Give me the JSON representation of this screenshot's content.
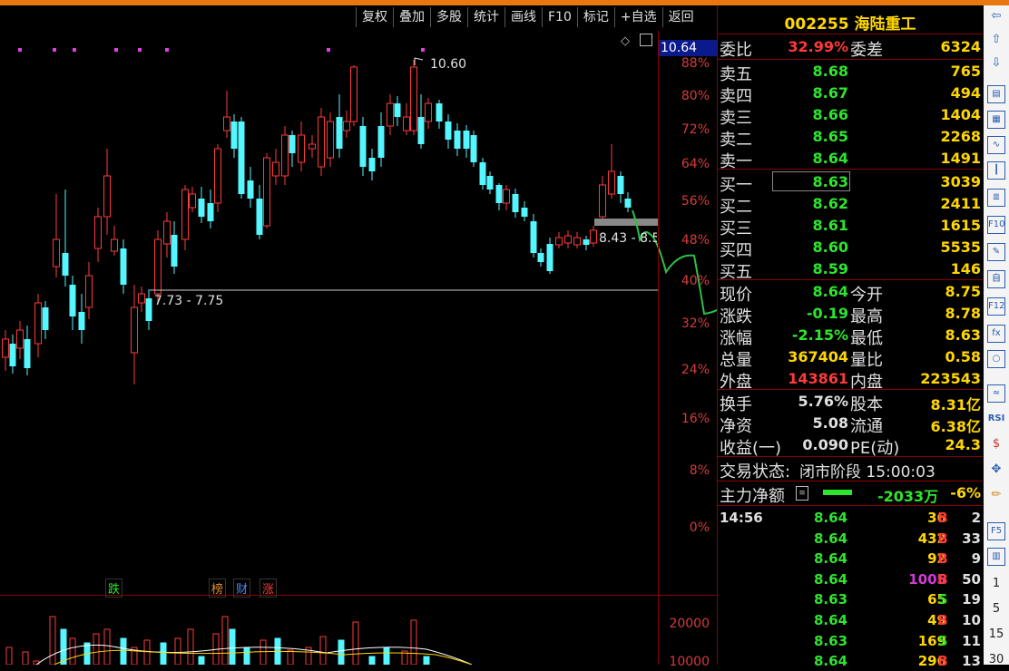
{
  "toolbar": {
    "items": [
      "复权",
      "叠加",
      "多股",
      "统计",
      "画线",
      "F10",
      "标记",
      "+自选",
      "返回"
    ]
  },
  "stock": {
    "code": "002255",
    "name": "海陆重工"
  },
  "chart": {
    "current_price_label": "10.64",
    "high_marker": "10.60",
    "range_label_1": "7.73 - 7.75",
    "range_label_2": "8.43 - 8.5",
    "pct_ticks": [
      "88%",
      "80%",
      "72%",
      "64%",
      "56%",
      "48%",
      "40%",
      "32%",
      "24%",
      "16%",
      "8%",
      "0%"
    ],
    "vol_ticks": [
      "20000",
      "10000"
    ],
    "badges": {
      "die": "跌",
      "bang": "榜",
      "cai": "财",
      "zhang": "涨"
    }
  },
  "chart_data": {
    "type": "candlestick",
    "high": 10.6,
    "support_range": "7.73 - 7.75",
    "resistance_range": "8.43 - 8.5"
  },
  "quote": {
    "weibi": {
      "label": "委比",
      "value": "32.99%",
      "label2": "委差",
      "value2": "6324"
    },
    "sell": [
      {
        "label": "卖五",
        "price": "8.68",
        "vol": "765"
      },
      {
        "label": "卖四",
        "price": "8.67",
        "vol": "494"
      },
      {
        "label": "卖三",
        "price": "8.66",
        "vol": "1404"
      },
      {
        "label": "卖二",
        "price": "8.65",
        "vol": "2268"
      },
      {
        "label": "卖一",
        "price": "8.64",
        "vol": "1491"
      }
    ],
    "buy": [
      {
        "label": "买一",
        "price": "8.63",
        "vol": "3039"
      },
      {
        "label": "买二",
        "price": "8.62",
        "vol": "2411"
      },
      {
        "label": "买三",
        "price": "8.61",
        "vol": "1615"
      },
      {
        "label": "买四",
        "price": "8.60",
        "vol": "5535"
      },
      {
        "label": "买五",
        "price": "8.59",
        "vol": "146"
      }
    ],
    "stats": [
      {
        "l1": "现价",
        "v1": "8.64",
        "l2": "今开",
        "v2": "8.75"
      },
      {
        "l1": "涨跌",
        "v1": "-0.19",
        "l2": "最高",
        "v2": "8.78"
      },
      {
        "l1": "涨幅",
        "v1": "-2.15%",
        "l2": "最低",
        "v2": "8.63"
      },
      {
        "l1": "总量",
        "v1": "367404",
        "l2": "量比",
        "v2": "0.58"
      },
      {
        "l1": "外盘",
        "v1": "143861",
        "l2": "内盘",
        "v2": "223543"
      }
    ],
    "stats2": [
      {
        "l1": "换手",
        "v1": "5.76%",
        "l2": "股本",
        "v2": "8.31亿"
      },
      {
        "l1": "净资",
        "v1": "5.08",
        "l2": "流通",
        "v2": "6.38亿"
      },
      {
        "l1": "收益(一)",
        "v1": "0.090",
        "l2": "PE(动)",
        "v2": "24.3"
      }
    ],
    "status_label": "交易状态:",
    "status_value": "闭市阶段 15:00:03",
    "mainforce_label": "主力净额",
    "mainforce_value": "-2033万",
    "mainforce_pct": "-6%"
  },
  "ticks": [
    {
      "time": "14:56",
      "price": "8.64",
      "qty": "36",
      "bs": "B",
      "n": "2"
    },
    {
      "time": "",
      "price": "8.64",
      "qty": "432",
      "bs": "B",
      "n": "33"
    },
    {
      "time": "",
      "price": "8.64",
      "qty": "92",
      "bs": "B",
      "n": "9"
    },
    {
      "time": "",
      "price": "8.64",
      "qty": "1005",
      "bs": "B",
      "n": "50"
    },
    {
      "time": "",
      "price": "8.63",
      "qty": "65",
      "bs": "S",
      "n": "19"
    },
    {
      "time": "",
      "price": "8.64",
      "qty": "49",
      "bs": "B",
      "n": "10"
    },
    {
      "time": "",
      "price": "8.63",
      "qty": "169",
      "bs": "S",
      "n": "11"
    },
    {
      "time": "",
      "price": "8.64",
      "qty": "296",
      "bs": "B",
      "n": "13"
    }
  ],
  "tools": {
    "arrows": [
      "⇦",
      "⇧",
      "⇩"
    ],
    "labels": [
      "RSI",
      "F10",
      "F12",
      "F5"
    ],
    "numbers": [
      "1",
      "5",
      "15",
      "30"
    ]
  }
}
